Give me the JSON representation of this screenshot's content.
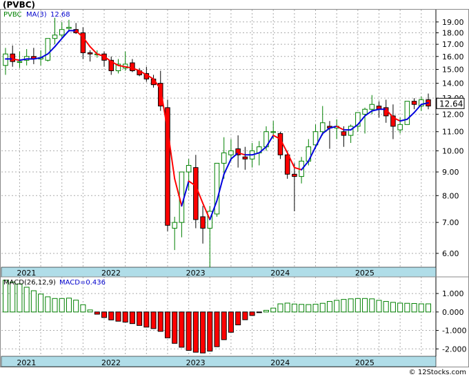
{
  "title": "(PVBC)",
  "watermark": "© 12Stocks.com",
  "price_panel": {
    "legend_symbol": "PVBC",
    "legend_ma_label": "MA(3)",
    "legend_ma_value": "12.68",
    "last_price": "12.64",
    "y_ticks": [
      "19.00",
      "18.00",
      "17.00",
      "16.00",
      "15.00",
      "14.00",
      "13.00",
      "12.00",
      "11.00",
      "10.00",
      "9.00",
      "8.00",
      "7.00",
      "6.00"
    ],
    "x_labels": [
      "2021",
      "2022",
      "2023",
      "2024",
      "2025"
    ]
  },
  "macd_panel": {
    "legend_label": "MACD(26,12,9)",
    "legend_value": "MACD=0.436",
    "y_ticks": [
      "1.000",
      "0.000",
      "-1.000",
      "-2.000"
    ],
    "x_labels": [
      "2021",
      "2022",
      "2023",
      "2024",
      "2025"
    ]
  },
  "colors": {
    "up_candle": "#008000",
    "down_candle": "#ff0000",
    "ma_up": "#0000dd",
    "ma_down": "#ff0000",
    "axis_band": "#b0dde8",
    "grid": "#aaaaaa",
    "legend_green": "#008000",
    "legend_blue": "#0000cc"
  },
  "chart_data": [
    {
      "type": "candlestick",
      "scale": "log",
      "ylim": [
        5.6,
        20.2
      ],
      "periods": [
        "2020-11",
        "2020-12",
        "2021-01",
        "2021-02",
        "2021-03",
        "2021-04",
        "2021-05",
        "2021-06",
        "2021-07",
        "2021-08",
        "2021-09",
        "2021-10",
        "2021-11",
        "2021-12",
        "2022-01",
        "2022-02",
        "2022-03",
        "2022-04",
        "2022-05",
        "2022-06",
        "2022-07",
        "2022-08",
        "2022-09",
        "2022-10",
        "2022-11",
        "2022-12",
        "2023-01",
        "2023-02",
        "2023-03",
        "2023-04",
        "2023-05",
        "2023-06",
        "2023-07",
        "2023-08",
        "2023-09",
        "2023-10",
        "2023-11",
        "2023-12",
        "2024-01",
        "2024-02",
        "2024-03",
        "2024-04",
        "2024-05",
        "2024-06",
        "2024-07",
        "2024-08",
        "2024-09",
        "2024-10",
        "2024-11",
        "2024-12",
        "2025-01",
        "2025-02",
        "2025-03",
        "2025-04",
        "2025-05",
        "2025-06",
        "2025-07",
        "2025-08",
        "2025-09",
        "2025-10",
        "2025-11"
      ],
      "ohlc": [
        [
          15.3,
          16.7,
          14.6,
          16.2
        ],
        [
          16.2,
          16.9,
          15.2,
          15.6
        ],
        [
          15.6,
          16.4,
          15.1,
          15.6
        ],
        [
          15.7,
          16.6,
          15.3,
          16.0
        ],
        [
          16.0,
          16.7,
          15.4,
          15.8
        ],
        [
          15.8,
          16.5,
          15.3,
          15.9
        ],
        [
          15.7,
          17.5,
          15.6,
          17.5
        ],
        [
          17.5,
          19.4,
          17.0,
          17.8
        ],
        [
          17.8,
          19.0,
          17.6,
          18.3
        ],
        [
          18.4,
          19.2,
          18.1,
          18.5
        ],
        [
          18.3,
          18.9,
          17.9,
          18.0
        ],
        [
          18.0,
          18.5,
          15.8,
          16.3
        ],
        [
          16.3,
          16.5,
          15.6,
          16.2
        ],
        [
          16.2,
          16.5,
          15.9,
          16.2
        ],
        [
          16.2,
          16.4,
          15.2,
          15.7
        ],
        [
          15.7,
          16.0,
          14.6,
          14.9
        ],
        [
          14.9,
          15.8,
          14.7,
          15.4
        ],
        [
          15.1,
          16.4,
          14.9,
          15.4
        ],
        [
          15.5,
          15.8,
          14.8,
          14.9
        ],
        [
          14.9,
          15.1,
          14.5,
          14.6
        ],
        [
          14.7,
          15.2,
          14.1,
          14.3
        ],
        [
          14.3,
          14.6,
          13.7,
          13.9
        ],
        [
          14.0,
          14.9,
          12.2,
          12.5
        ],
        [
          12.4,
          12.9,
          6.7,
          6.9
        ],
        [
          6.8,
          7.2,
          6.1,
          7.0
        ],
        [
          7.0,
          7.5,
          6.5,
          9.0
        ],
        [
          9.0,
          9.6,
          8.2,
          9.3
        ],
        [
          9.2,
          9.8,
          6.8,
          7.1
        ],
        [
          7.2,
          7.6,
          6.3,
          6.8
        ],
        [
          6.8,
          7.6,
          5.6,
          7.4
        ],
        [
          7.3,
          9.0,
          7.2,
          9.4
        ],
        [
          9.4,
          10.7,
          8.7,
          9.9
        ],
        [
          9.8,
          10.6,
          9.5,
          10.0
        ],
        [
          10.1,
          10.8,
          9.2,
          9.8
        ],
        [
          9.7,
          10.2,
          9.1,
          9.6
        ],
        [
          9.6,
          10.4,
          9.2,
          10.0
        ],
        [
          9.9,
          10.5,
          9.3,
          10.2
        ],
        [
          10.2,
          11.3,
          10.0,
          11.0
        ],
        [
          11.0,
          11.6,
          10.6,
          11.0
        ],
        [
          10.9,
          11.0,
          9.6,
          9.8
        ],
        [
          9.8,
          10.0,
          8.7,
          8.9
        ],
        [
          8.9,
          9.4,
          7.4,
          8.8
        ],
        [
          8.8,
          9.7,
          8.5,
          9.5
        ],
        [
          9.5,
          10.6,
          9.3,
          10.2
        ],
        [
          10.3,
          11.4,
          10.1,
          11.0
        ],
        [
          11.0,
          12.5,
          10.8,
          11.5
        ],
        [
          11.3,
          11.6,
          10.1,
          11.2
        ],
        [
          11.2,
          11.7,
          10.6,
          11.3
        ],
        [
          11.0,
          11.3,
          10.2,
          10.8
        ],
        [
          10.8,
          11.4,
          10.4,
          11.3
        ],
        [
          11.3,
          12.0,
          11.0,
          12.1
        ],
        [
          12.0,
          12.4,
          10.9,
          12.3
        ],
        [
          12.3,
          13.2,
          12.0,
          12.6
        ],
        [
          12.5,
          12.8,
          11.8,
          12.3
        ],
        [
          12.4,
          12.9,
          11.5,
          11.9
        ],
        [
          11.9,
          12.6,
          10.6,
          11.3
        ],
        [
          11.1,
          11.8,
          10.9,
          11.4
        ],
        [
          11.4,
          12.5,
          11.4,
          12.8
        ],
        [
          12.8,
          13.0,
          12.3,
          12.6
        ],
        [
          12.5,
          13.1,
          12.2,
          12.9
        ],
        [
          12.9,
          13.3,
          12.3,
          12.5
        ]
      ],
      "ma3": [
        15.8,
        15.8,
        15.7,
        15.8,
        15.8,
        15.9,
        16.2,
        16.8,
        17.5,
        18.2,
        18.2,
        17.6,
        16.8,
        16.2,
        16.0,
        15.6,
        15.3,
        15.2,
        15.1,
        14.9,
        14.6,
        14.3,
        13.6,
        11.1,
        8.7,
        7.6,
        8.6,
        8.4,
        7.7,
        7.1,
        7.8,
        8.9,
        9.6,
        9.9,
        9.8,
        9.8,
        9.9,
        10.2,
        10.8,
        10.6,
        9.9,
        9.2,
        9.1,
        9.5,
        10.2,
        10.9,
        11.2,
        11.3,
        11.1,
        11.1,
        11.4,
        11.9,
        12.2,
        12.3,
        12.3,
        11.8,
        11.6,
        11.7,
        12.1,
        12.6,
        12.7
      ],
      "ma_name": "MA(3)"
    },
    {
      "type": "bar",
      "ylim": [
        -2.4,
        1.9
      ],
      "macd": [
        1.72,
        1.62,
        1.52,
        1.34,
        1.15,
        0.97,
        0.82,
        0.73,
        0.73,
        0.75,
        0.64,
        0.39,
        0.11,
        -0.12,
        -0.3,
        -0.43,
        -0.5,
        -0.55,
        -0.63,
        -0.73,
        -0.82,
        -0.9,
        -1.05,
        -1.4,
        -1.7,
        -1.91,
        -2.08,
        -2.18,
        -2.22,
        -2.12,
        -1.88,
        -1.5,
        -1.1,
        -0.7,
        -0.42,
        -0.19,
        -0.02,
        0.09,
        0.21,
        0.44,
        0.48,
        0.43,
        0.41,
        0.4,
        0.42,
        0.47,
        0.57,
        0.63,
        0.68,
        0.71,
        0.73,
        0.73,
        0.71,
        0.63,
        0.57,
        0.52,
        0.48,
        0.47,
        0.46,
        0.44,
        0.44
      ]
    }
  ]
}
